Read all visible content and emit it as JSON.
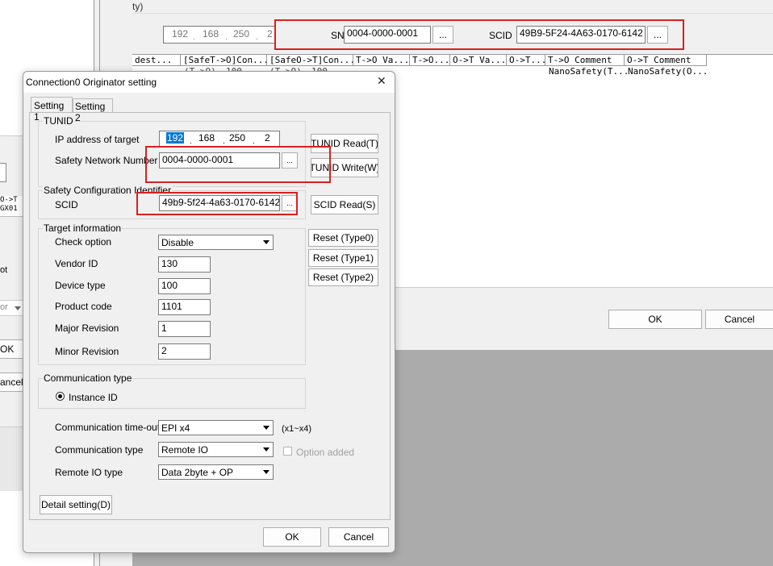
{
  "bg_right": {
    "top_fragment": "ty)",
    "ip": [
      "192",
      "168",
      "250",
      "2"
    ],
    "snn_label": "SNN",
    "snn_value": "0004-0000-0001",
    "scid_label": "SCID",
    "scid_value": "49B9-5F24-4A63-0170-6142",
    "browse_label": "...",
    "table_headers": [
      "dest...",
      "[SafeT->O]Con...",
      "[SafeO->T]Con...",
      "T->O Va...",
      "T->O...",
      "O->T Va...",
      "O->T...",
      "T->O Comment",
      "O->T Comment"
    ],
    "row1": [
      "(T->O)",
      "100",
      "(T->O)",
      "100",
      "NanoSafety(T...",
      "NanoSafety(O..."
    ],
    "ok_label": "OK",
    "cancel_label": "Cancel"
  },
  "bg_left": {
    "header_frag1": "O->T",
    "header_frag2": "GX01",
    "frag_ot": "ot",
    "frag_or": "or",
    "ok_frag": "OK",
    "cancel_frag": "ancel"
  },
  "dialog": {
    "title": "Connection0 Originator setting",
    "close_glyph": "✕",
    "tabs": [
      "Setting 1",
      "Setting 2"
    ],
    "tunid": {
      "group_title": "TUNID",
      "ip_label": "IP address of target",
      "ip": [
        "192",
        "168",
        "250",
        "2"
      ],
      "snn_label": "Safety Network Number",
      "snn_value": "0004-0000-0001",
      "browse_label": "...",
      "read_button": "TUNID Read(T)",
      "write_button": "TUNID Write(W)"
    },
    "scid": {
      "group_title": "Safety Configuration Identifier",
      "label": "SCID",
      "value": "49b9-5f24-4a63-0170-6142",
      "browse_label": "...",
      "read_button": "SCID Read(S)"
    },
    "target": {
      "group_title": "Target information",
      "check_option_label": "Check option",
      "check_option_value": "Disable",
      "vendor_label": "Vendor ID",
      "vendor_value": "130",
      "device_label": "Device type",
      "device_value": "100",
      "product_label": "Product code",
      "product_value": "1101",
      "major_label": "Major Revision",
      "major_value": "1",
      "minor_label": "Minor Revision",
      "minor_value": "2",
      "reset0": "Reset (Type0)",
      "reset1": "Reset (Type1)",
      "reset2": "Reset (Type2)"
    },
    "comm": {
      "group_title": "Communication type",
      "radio_label": "Instance ID",
      "timeout_label": "Communication time-out",
      "timeout_value": "EPI x4",
      "timeout_hint": "(x1~x4)",
      "type_label": "Communication type",
      "type_value": "Remote IO",
      "option_added_label": "Option added",
      "remote_label": "Remote IO type",
      "remote_value": "Data 2byte + OP"
    },
    "detail_button": "Detail setting(D)",
    "ok_button": "OK",
    "cancel_button": "Cancel"
  },
  "colors": {
    "highlight_red": "#d9201e",
    "selection_blue": "#0078d7",
    "dialog_bg": "#f0f0f0",
    "gray_area": "#ababab"
  }
}
